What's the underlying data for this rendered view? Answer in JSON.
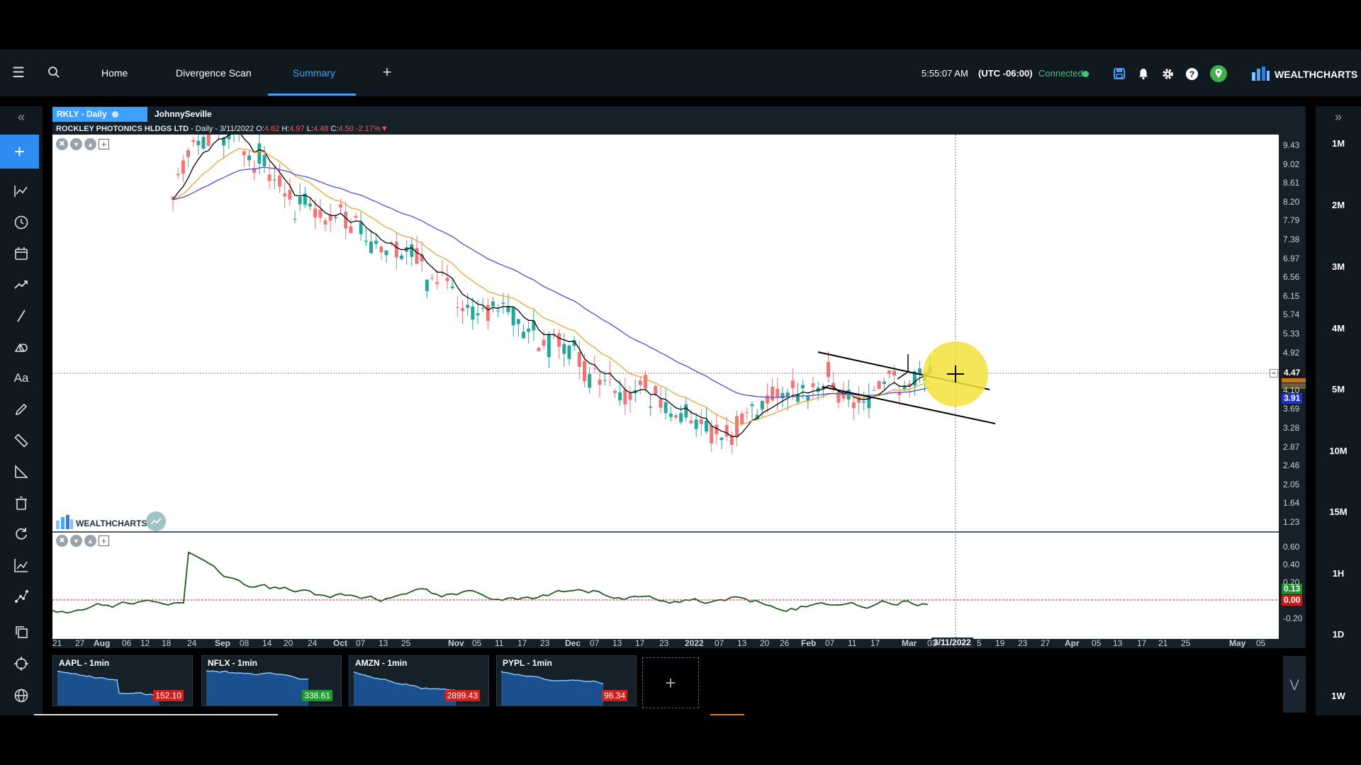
{
  "nav": {
    "tabs": [
      {
        "label": "Home"
      },
      {
        "label": "Divergence Scan"
      },
      {
        "label": "Summary",
        "active": true
      }
    ]
  },
  "status": {
    "time": "5:55:07 AM",
    "timezone": "(UTC -06:00)",
    "connection": "Connected"
  },
  "brand": {
    "name": "WEALTHCHARTS",
    "accent": "#3ea0ff"
  },
  "chart_tabs": [
    {
      "label": "RKLY - Daily",
      "active": true
    },
    {
      "label": "JohnnySeville",
      "active": false
    }
  ],
  "info": {
    "name": "ROCKLEY PHOTONICS HLDGS LTD",
    "meta": " - Daily - 3/11/2022",
    "o_label": "O:",
    "o": "4.62",
    "h_label": "H:",
    "h": "4.97",
    "l_label": "L:",
    "l": "4.48",
    "c_label": "C:",
    "c": "4.50",
    "change": "-2.17%"
  },
  "watermark": "WEALTHCHARTS",
  "price_axis": [
    "9.43",
    "9.02",
    "8.61",
    "8.20",
    "7.79",
    "7.38",
    "6.97",
    "6.56",
    "6.15",
    "5.74",
    "5.33",
    "4.92",
    "4.10",
    "3.69",
    "3.28",
    "2.87",
    "2.46",
    "2.05",
    "1.64",
    "1.23"
  ],
  "price_badges": {
    "current": "4.47",
    "level": "3.91"
  },
  "osc_axis": [
    "0.60",
    "0.40",
    "0.20",
    "-0.20"
  ],
  "osc_badges": {
    "value": "0.13",
    "zero": "0.00"
  },
  "time_axis": [
    "21",
    "27",
    "Aug",
    "06",
    "12",
    "18",
    "24",
    "Sep",
    "08",
    "14",
    "20",
    "24",
    "Oct",
    "07",
    "13",
    "25",
    "Nov",
    "05",
    "11",
    "17",
    "23",
    "Dec",
    "07",
    "13",
    "17",
    "23",
    "2022",
    "07",
    "13",
    "20",
    "26",
    "Feb",
    "07",
    "11",
    "17",
    "Mar",
    "03",
    "5",
    "19",
    "23",
    "27",
    "Apr",
    "05",
    "13",
    "17",
    "21",
    "25",
    "May",
    "05"
  ],
  "crosshair_date": "3/11/2022",
  "timeframes": [
    "1M",
    "2M",
    "3M",
    "4M",
    "5M",
    "10M",
    "15M",
    "1H",
    "1D",
    "1W"
  ],
  "minis": [
    {
      "label": "AAPL - 1min",
      "price": "152.10",
      "color": "#d0201e"
    },
    {
      "label": "NFLX - 1min",
      "price": "338.61",
      "color": "#1f9a2e"
    },
    {
      "label": "AMZN - 1min",
      "price": "2899.43",
      "color": "#d0201e"
    },
    {
      "label": "PYPL - 1min",
      "price": "96.34",
      "color": "#d0201e"
    }
  ],
  "colors": {
    "up": "#26a69a",
    "down": "#ef7676",
    "ema_fast": "#000000",
    "ema_mid": "#e8a33a",
    "ema_slow": "#4b4fc4"
  }
}
